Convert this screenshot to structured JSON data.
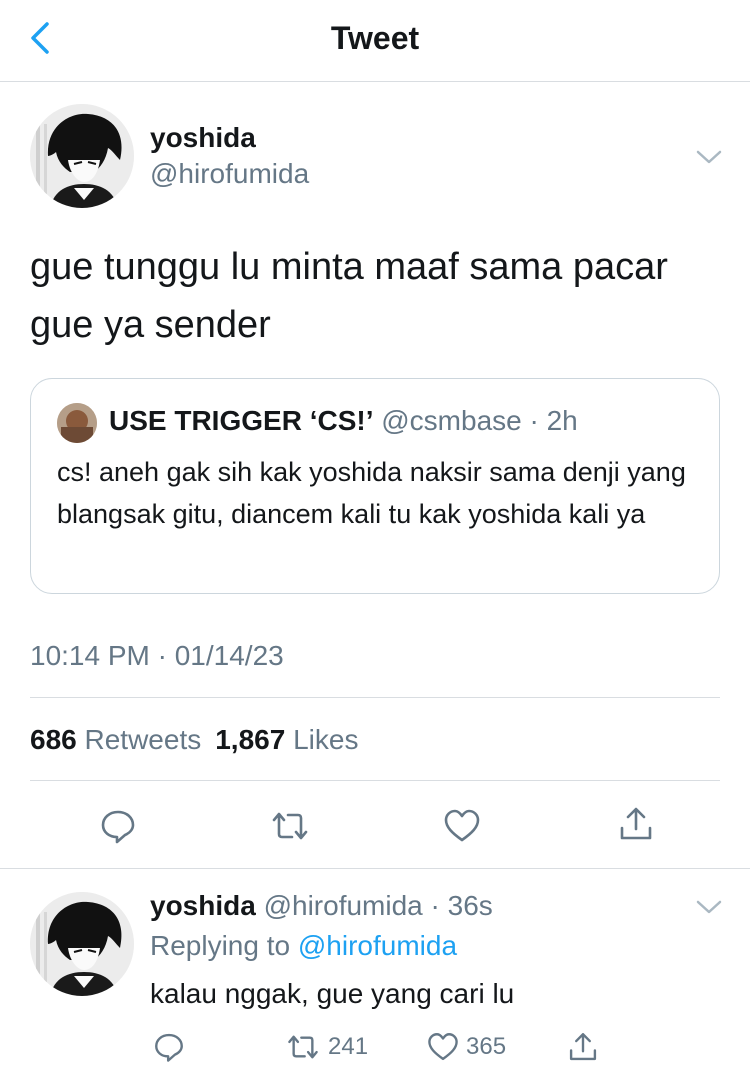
{
  "header": {
    "title": "Tweet"
  },
  "tweet": {
    "author_name": "yoshida",
    "author_handle": "@hirofumida",
    "text": "gue tunggu lu minta maaf sama pacar gue ya sender",
    "quote": {
      "author_name": "USE TRIGGER ‘CS!’",
      "author_handle": "@csmbase",
      "separator": "·",
      "time": "2h",
      "text": "cs! aneh gak sih kak yoshida naksir sama denji yang blangsak gitu, diancem kali tu kak yoshida kali ya"
    },
    "timestamp": "10:14 PM · 01/14/23",
    "retweets_count": "686",
    "retweets_label": "Retweets",
    "likes_count": "1,867",
    "likes_label": "Likes"
  },
  "reply": {
    "author_name": "yoshida",
    "author_handle": "@hirofumida",
    "separator": "·",
    "time": "36s",
    "replying_prefix": "Replying to",
    "replying_handle": "@hirofumida",
    "text": "kalau nggak, gue yang cari lu",
    "retweet_count": "241",
    "like_count": "365"
  },
  "colors": {
    "accent": "#1da1f2",
    "muted": "#657786",
    "text": "#14171a",
    "divider": "#d9dde1"
  },
  "icons": [
    "back-icon",
    "chevron-down-icon",
    "reply-icon",
    "retweet-icon",
    "heart-icon",
    "share-icon"
  ]
}
